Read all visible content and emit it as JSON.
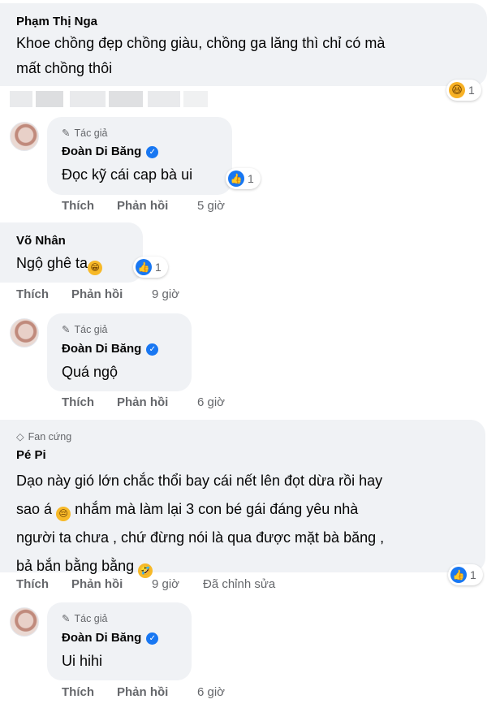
{
  "comments": [
    {
      "author": "Phạm Thị Nga",
      "text_line1": "Khoe chồng đẹp chồng giàu, chồng ga lăng thì chỉ có mà",
      "text_line2": "mất chồng thôi",
      "reaction": {
        "icon": "haha-icon",
        "count": "1"
      },
      "actions": []
    },
    {
      "role": "Tác giả",
      "author": "Đoàn Di Băng",
      "text": "Đọc kỹ cái cap bà ui",
      "reaction": {
        "icon": "like-icon",
        "count": "1"
      },
      "actions": {
        "like": "Thích",
        "reply": "Phản hồi",
        "time": "5 giờ"
      }
    },
    {
      "author": "Võ Nhân",
      "text": "Ngộ ghê ta",
      "text_emoji": "grin-icon",
      "reaction": {
        "icon": "like-icon",
        "count": "1"
      },
      "actions": {
        "like": "Thích",
        "reply": "Phản hồi",
        "time": "9 giờ"
      }
    },
    {
      "role": "Tác giả",
      "author": "Đoàn Di Băng",
      "text": "Quá ngộ",
      "actions": {
        "like": "Thích",
        "reply": "Phản hồi",
        "time": "6 giờ"
      }
    },
    {
      "role": "Fan cứng",
      "author": "Pé Pi",
      "text_line1": "Dạo này gió lớn chắc thổi bay cái nết lên đọt dừa rồi hay",
      "text_line2_a": "sao á",
      "text_line2_b": " nhắm mà làm lại 3 con bé gái đáng yêu nhà",
      "text_line3": "người ta chưa , chứ đừng nói là qua được mặt bà băng ,",
      "text_line4": "bả bắn bằng bằng",
      "emoji_1": "pensive-icon",
      "emoji_2": "rofl-icon",
      "reaction": {
        "icon": "like-icon",
        "count": "1"
      },
      "actions": {
        "like": "Thích",
        "reply": "Phản hồi",
        "time": "9 giờ",
        "edited": "Đã chỉnh sửa"
      }
    },
    {
      "role": "Tác giả",
      "author": "Đoàn Di Băng",
      "text": "Ui hihi",
      "actions": {
        "like": "Thích",
        "reply": "Phản hồi",
        "time": "6 giờ"
      }
    }
  ]
}
